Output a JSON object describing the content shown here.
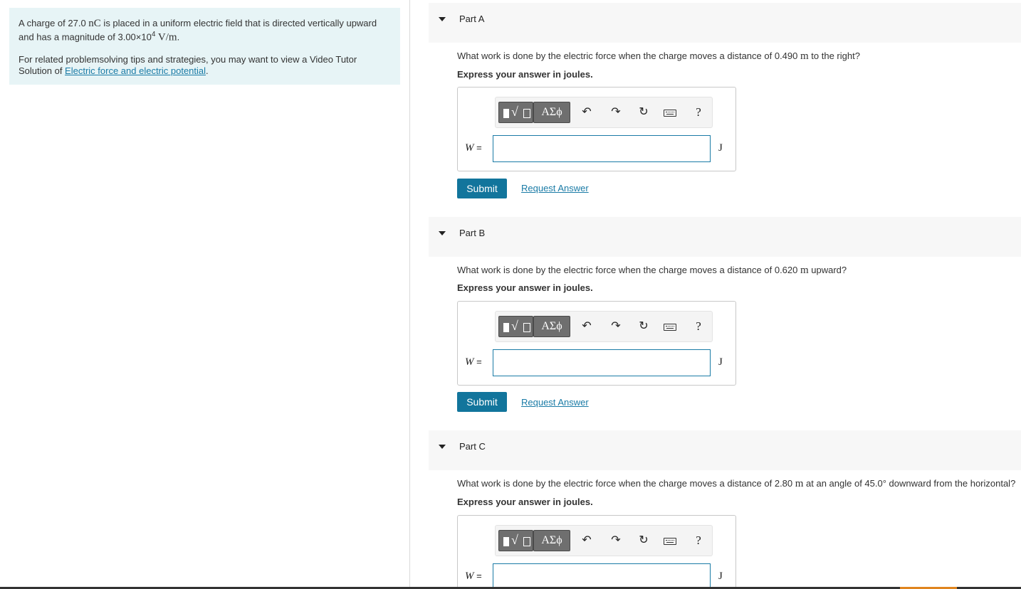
{
  "intro": {
    "line1_pre": "A charge of 27.0 ",
    "charge_unit": "nC",
    "line1_post": " is placed in a uniform electric field that is directed vertically upward",
    "line2_pre": "and has a magnitude of 3.00×10",
    "exponent": "4",
    "field_unit": " V/m",
    "line2_post": ".",
    "tips_line1": "For related problemsolving tips and strategies, you may want to view a Video Tutor",
    "tips_pre": "Solution of ",
    "tips_link": "Electric force and electric potential",
    "tips_post": "."
  },
  "toolbar": {
    "templates_icon": "templates-icon",
    "greek_label": "ΑΣϕ",
    "undo_glyph": "↶",
    "redo_glyph": "↷",
    "reset_glyph": "↻",
    "help_glyph": "?"
  },
  "answer": {
    "var": "W",
    "eq": " =",
    "unit": "J",
    "value": ""
  },
  "buttons": {
    "submit": "Submit",
    "request": "Request Answer"
  },
  "parts": [
    {
      "title": "Part A",
      "question_pre": "What work is done by the electric force when the charge moves a distance of 0.490 ",
      "question_unit": "m",
      "question_post": " to the right?",
      "instruction": "Express your answer in joules."
    },
    {
      "title": "Part B",
      "question_pre": "What work is done by the electric force when the charge moves a distance of 0.620 ",
      "question_unit": "m",
      "question_post": " upward?",
      "instruction": "Express your answer in joules."
    },
    {
      "title": "Part C",
      "question_pre": "What work is done by the electric force when the charge moves a distance of 2.80 ",
      "question_unit": "m",
      "question_post": " at an angle of 45.0° downward from the horizontal?",
      "instruction": "Express your answer in joules."
    }
  ]
}
